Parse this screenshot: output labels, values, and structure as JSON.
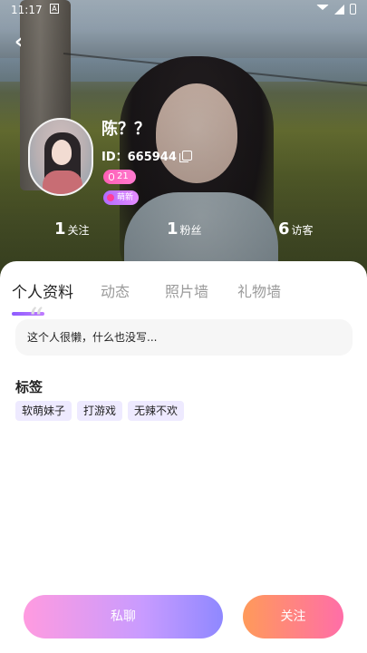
{
  "status_bar": {
    "time": "11:17",
    "notification_indicator": "A",
    "icons": [
      "wifi-icon",
      "signal-icon",
      "battery-icon"
    ]
  },
  "header": {
    "back_icon": "chevron-left-icon"
  },
  "profile": {
    "name": "陈？？",
    "id_text": "ID：665944",
    "level_badge": "21",
    "mood_badge": "萌新",
    "stats": [
      {
        "value": "1",
        "label": "关注"
      },
      {
        "value": "1",
        "label": "粉丝"
      },
      {
        "value": "6",
        "label": "访客"
      }
    ]
  },
  "tabs": [
    {
      "label": "个人资料",
      "active": true
    },
    {
      "label": "动态",
      "active": false
    },
    {
      "label": "照片墙",
      "active": false
    },
    {
      "label": "礼物墙",
      "active": false
    }
  ],
  "bio": {
    "quote_icon": "quote-icon",
    "text": "这个人很懒，什么也没写..."
  },
  "tags_section": {
    "title": "标签",
    "tags": [
      "软萌妹子",
      "打游戏",
      "无辣不欢"
    ]
  },
  "actions": {
    "chat_label": "私聊",
    "follow_label": "关注"
  },
  "colors": {
    "tab_underline": "#8d5bff",
    "chat_gradient": [
      "#ff9be0",
      "#8f88ff"
    ],
    "follow_gradient": [
      "#ff9a5a",
      "#ff6ea8"
    ],
    "tag_bg": "#eeeaff"
  }
}
